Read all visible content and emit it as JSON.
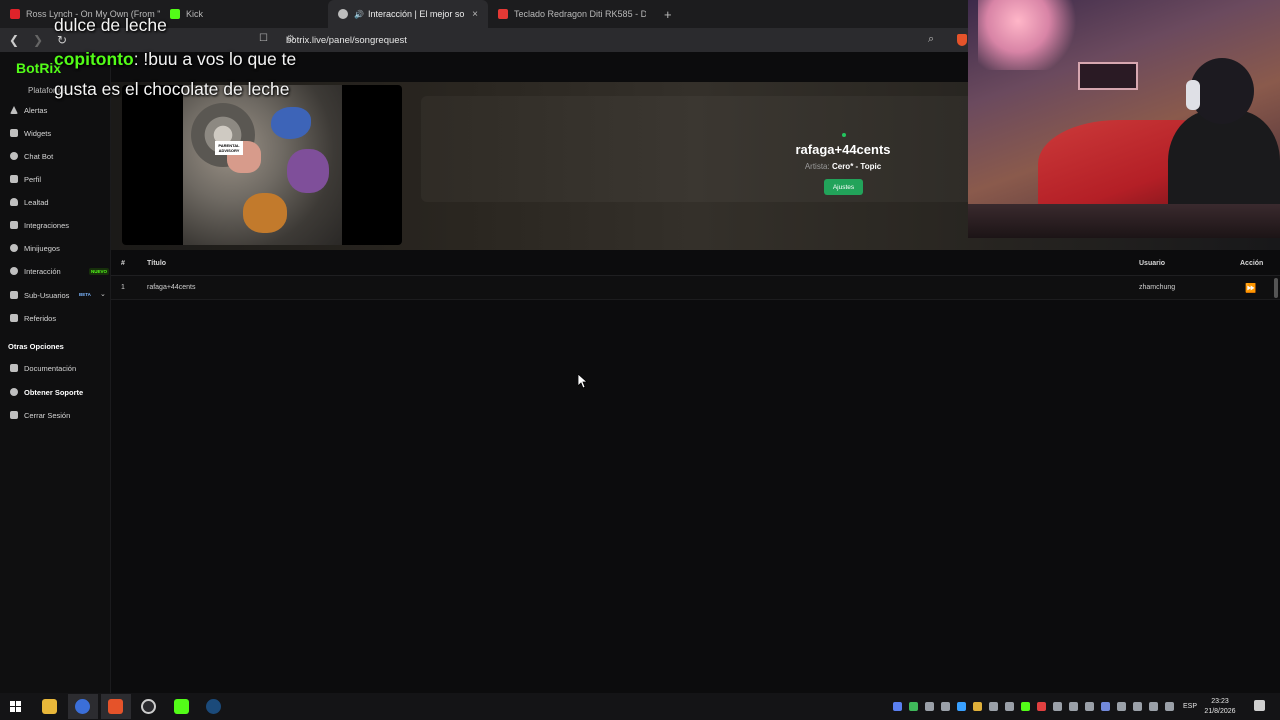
{
  "browser": {
    "tabs": [
      {
        "title": "Ross Lynch - On My Own (From \"Te...",
        "fav_color": "#e0232a",
        "active": false
      },
      {
        "title": "Kick",
        "fav_color": "#53fc18",
        "active": false
      },
      {
        "title": "Interacción | El mejor softwa...",
        "fav_color": "#bdbdbd",
        "active": true
      },
      {
        "title": "Teclado Redragon Diti RK585 - Diam...",
        "fav_color": "#e53935",
        "active": false
      }
    ],
    "tab_close": "×",
    "tab_new": "+",
    "url": "botrix.live/panel/songrequest"
  },
  "sidebar": {
    "brand": "BotRix",
    "brand_sub": "Plataforma",
    "items": [
      {
        "label": "Alertas"
      },
      {
        "label": "Widgets"
      },
      {
        "label": "Chat Bot"
      },
      {
        "label": "Perfil"
      },
      {
        "label": "Lealtad"
      },
      {
        "label": "Integraciones"
      },
      {
        "label": "Minijuegos"
      },
      {
        "label": "Interacción",
        "badge": "NUEVO"
      },
      {
        "label": "Sub-Usuarios",
        "badge": "BETA"
      },
      {
        "label": "Referidos"
      }
    ],
    "section": "Otras Opciones",
    "other_items": [
      {
        "label": "Documentación"
      },
      {
        "label": "Obtener Soporte"
      },
      {
        "label": "Cerrar Sesión"
      }
    ]
  },
  "now_playing": {
    "title": "rafaga+44cents",
    "artist_label": "Artista:",
    "artist": "Cero* - Topic",
    "settings_button": "Ajustes",
    "cover_label": "PARENTAL ADVISORY"
  },
  "queue": {
    "headers": {
      "index": "#",
      "title": "Título",
      "user": "Usuario",
      "action": "Acción"
    },
    "rows": [
      {
        "index": "1",
        "title": "rafaga+44cents",
        "user": "zhamchung"
      }
    ],
    "action_icon": "skip-forward-icon"
  },
  "chat_overlay": {
    "lines": [
      {
        "text": "dulce de leche"
      },
      {
        "user": "copitonto",
        "text": ": !buu a vos lo que te"
      },
      {
        "text": "gusta es el chocolate de leche"
      }
    ]
  },
  "taskbar": {
    "lang": "ESP",
    "time": "23:23",
    "date": "21/8/2026"
  },
  "colors": {
    "brand": "#53fc18",
    "accent_button": "#22a35a",
    "status_dot": "#22c55e"
  }
}
